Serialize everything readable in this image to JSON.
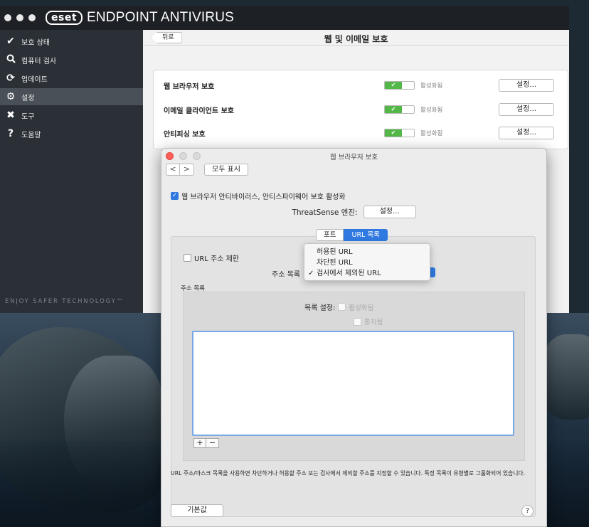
{
  "window": {
    "brand_logo": "eset",
    "app_name": "ENDPOINT ANTIVIRUS"
  },
  "sidebar": {
    "items": [
      {
        "icon": "✔",
        "label": "보호 상태",
        "active": false
      },
      {
        "icon": "🔍︎",
        "label": "컴퓨터 검사",
        "active": false
      },
      {
        "icon": "⟳",
        "label": "업데이트",
        "active": false
      },
      {
        "icon": "⚙",
        "label": "설정",
        "active": true
      },
      {
        "icon": "✖",
        "label": "도구",
        "active": false
      },
      {
        "icon": "?",
        "label": "도움말",
        "active": false
      }
    ],
    "tagline": "ENJOY SAFER TECHNOLOGY™"
  },
  "content": {
    "back_label": "뒤로",
    "title": "웹 및 이메일 보호",
    "rows": [
      {
        "label": "웹 브라우저 보호",
        "state": "활성화됨",
        "button": "설정..."
      },
      {
        "label": "이메일 클라이언트 보호",
        "state": "활성화됨",
        "button": "설정..."
      },
      {
        "label": "안티피싱 보호",
        "state": "활성화됨",
        "button": "설정..."
      }
    ],
    "toggle_glyph": "✔"
  },
  "dialog": {
    "title": "웹 브라우저 보호",
    "nav_back": "<",
    "nav_forward": ">",
    "show_all": "모두 표시",
    "enable_label": "웹 브라우저 안티바이러스, 안티스파이웨어 보호 활성화",
    "threatsense_label": "ThreatSense 엔진:",
    "threatsense_button": "설정...",
    "tabs": [
      "포트",
      "URL 목록"
    ],
    "url_limit_label": "URL 주소 제한",
    "address_list_label": "주소 목록",
    "address_section_title": "주소 목록",
    "list_setting_label": "목록 설정:",
    "list_enabled": "활성화됨",
    "list_notify": "통지됨",
    "plus": "+",
    "minus": "−",
    "description": "URL 주소/마스크 목록을 사용하면 차단하거나 허용할 주소 또는 검사에서 제외할 주소를 지정할 수 있습니다. 특정 목록이 유형별로 그룹화되어 있습니다.",
    "default_button": "기본값",
    "help": "?"
  },
  "dropdown": {
    "options": [
      {
        "label": "허용된 URL",
        "checked": false
      },
      {
        "label": "차단된 URL",
        "checked": false
      },
      {
        "label": "검사에서 제외된 URL",
        "checked": true
      }
    ],
    "check_glyph": "✓"
  }
}
